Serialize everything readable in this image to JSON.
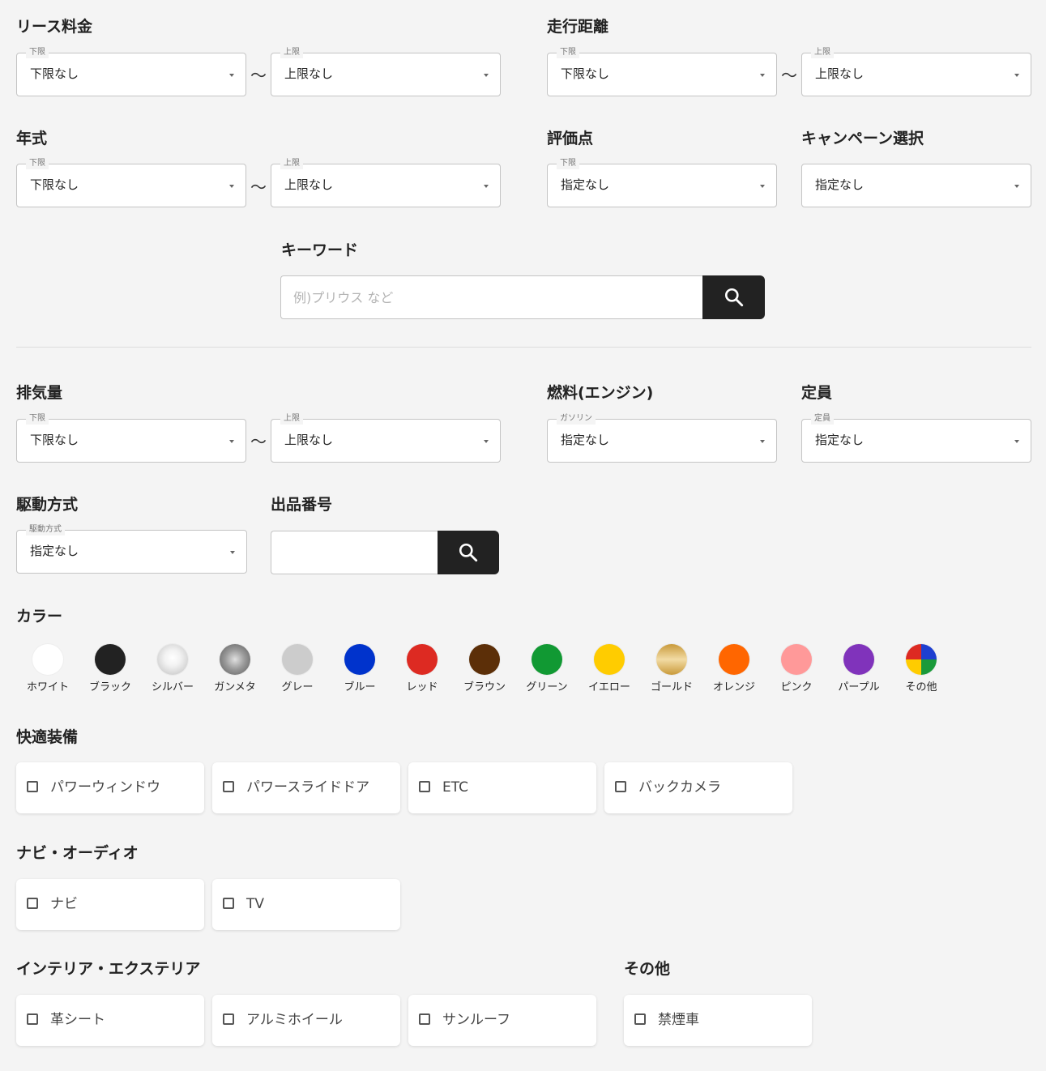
{
  "lease": {
    "title": "リース料金",
    "min": {
      "legend": "下限",
      "value": "下限なし"
    },
    "max": {
      "legend": "上限",
      "value": "上限なし"
    }
  },
  "mileage": {
    "title": "走行距離",
    "min": {
      "legend": "下限",
      "value": "下限なし"
    },
    "max": {
      "legend": "上限",
      "value": "上限なし"
    }
  },
  "year": {
    "title": "年式",
    "min": {
      "legend": "下限",
      "value": "下限なし"
    },
    "max": {
      "legend": "上限",
      "value": "上限なし"
    }
  },
  "rating": {
    "title": "評価点",
    "legend": "下限",
    "value": "指定なし"
  },
  "campaign": {
    "title": "キャンペーン選択",
    "value": "指定なし"
  },
  "tilde": "〜",
  "keyword": {
    "title": "キーワード",
    "placeholder": "例)プリウス など"
  },
  "displacement": {
    "title": "排気量",
    "min": {
      "legend": "下限",
      "value": "下限なし"
    },
    "max": {
      "legend": "上限",
      "value": "上限なし"
    }
  },
  "fuel": {
    "title": "燃料(エンジン)",
    "legend": "ガソリン",
    "value": "指定なし"
  },
  "capacity": {
    "title": "定員",
    "legend": "定員",
    "value": "指定なし"
  },
  "drive": {
    "title": "駆動方式",
    "legend": "駆動方式",
    "value": "指定なし"
  },
  "listing": {
    "title": "出品番号"
  },
  "color": {
    "title": "カラー",
    "items": [
      {
        "name": "ホワイト",
        "hex": "#ffffff"
      },
      {
        "name": "ブラック",
        "hex": "#222222"
      },
      {
        "name": "シルバー",
        "hex": "#d8d8d8"
      },
      {
        "name": "ガンメタ",
        "hex": "#8a8a8a"
      },
      {
        "name": "グレー",
        "hex": "#cccccc"
      },
      {
        "name": "ブルー",
        "hex": "#0033cc"
      },
      {
        "name": "レッド",
        "hex": "#dd2a22"
      },
      {
        "name": "ブラウン",
        "hex": "#5c2f08"
      },
      {
        "name": "グリーン",
        "hex": "#119933"
      },
      {
        "name": "イエロー",
        "hex": "#ffcc00"
      },
      {
        "name": "ゴールド",
        "hex": "#d8b160"
      },
      {
        "name": "オレンジ",
        "hex": "#ff6600"
      },
      {
        "name": "ピンク",
        "hex": "#ff9999"
      },
      {
        "name": "パープル",
        "hex": "#8033bb"
      },
      {
        "name": "その他",
        "hex": "multi"
      }
    ]
  },
  "comfort": {
    "title": "快適装備",
    "items": [
      "パワーウィンドウ",
      "パワースライドドア",
      "ETC",
      "バックカメラ"
    ]
  },
  "navi": {
    "title": "ナビ・オーディオ",
    "items": [
      "ナビ",
      "TV"
    ]
  },
  "interior": {
    "title": "インテリア・エクステリア",
    "items": [
      "革シート",
      "アルミホイール",
      "サンルーフ"
    ]
  },
  "other": {
    "title": "その他",
    "items": [
      "禁煙車"
    ]
  }
}
